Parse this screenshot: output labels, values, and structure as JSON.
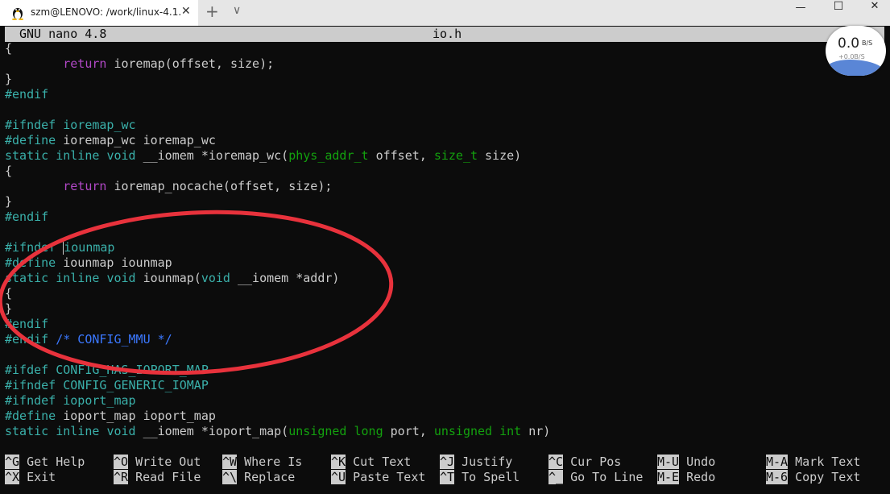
{
  "window": {
    "tab_title": "szm@LENOVO: /work/linux-4.1.",
    "tab_close": "✕",
    "new_tab": "+",
    "tab_menu": "∨",
    "minimize": "—",
    "maximize": "☐",
    "close": "✕"
  },
  "nano": {
    "version": "GNU nano 4.8",
    "filename": "io.h"
  },
  "network_widget": {
    "speed": "0.0",
    "unit": "B/S",
    "sub": "+0.0B/S"
  },
  "code_lines": [
    "{",
    "        return ioremap(offset, size);",
    "}",
    "#endif",
    "",
    "#ifndef ioremap_wc",
    "#define ioremap_wc ioremap_wc",
    "static inline void __iomem *ioremap_wc(phys_addr_t offset, size_t size)",
    "{",
    "        return ioremap_nocache(offset, size);",
    "}",
    "#endif",
    "",
    "#ifndef iounmap",
    "#define iounmap iounmap",
    "static inline void iounmap(void __iomem *addr)",
    "{",
    "}",
    "#endif",
    "#endif /* CONFIG_MMU */",
    "",
    "#ifdef CONFIG_HAS_IOPORT_MAP",
    "#ifndef CONFIG_GENERIC_IOMAP",
    "#ifndef ioport_map",
    "#define ioport_map ioport_map",
    "static inline void __iomem *ioport_map(unsigned long port, unsigned int nr)"
  ],
  "shortcuts_row1": [
    {
      "key": "^G",
      "label": "Get Help"
    },
    {
      "key": "^O",
      "label": "Write Out"
    },
    {
      "key": "^W",
      "label": "Where Is"
    },
    {
      "key": "^K",
      "label": "Cut Text"
    },
    {
      "key": "^J",
      "label": "Justify"
    },
    {
      "key": "^C",
      "label": "Cur Pos"
    },
    {
      "key": "M-U",
      "label": "Undo"
    },
    {
      "key": "M-A",
      "label": "Mark Text"
    }
  ],
  "shortcuts_row2": [
    {
      "key": "^X",
      "label": "Exit"
    },
    {
      "key": "^R",
      "label": "Read File"
    },
    {
      "key": "^\\",
      "label": "Replace"
    },
    {
      "key": "^U",
      "label": "Paste Text"
    },
    {
      "key": "^T",
      "label": "To Spell"
    },
    {
      "key": "^_",
      "label": "Go To Line"
    },
    {
      "key": "M-E",
      "label": "Redo"
    },
    {
      "key": "M-6",
      "label": "Copy Text"
    }
  ],
  "colors": {
    "terminal_bg": "#0c0c0c",
    "text": "#cccccc",
    "keyword": "#3ab0aa",
    "type": "#13a10e",
    "return": "#b148c6",
    "comment": "#3b78ff",
    "annotation": "#e8323c"
  }
}
